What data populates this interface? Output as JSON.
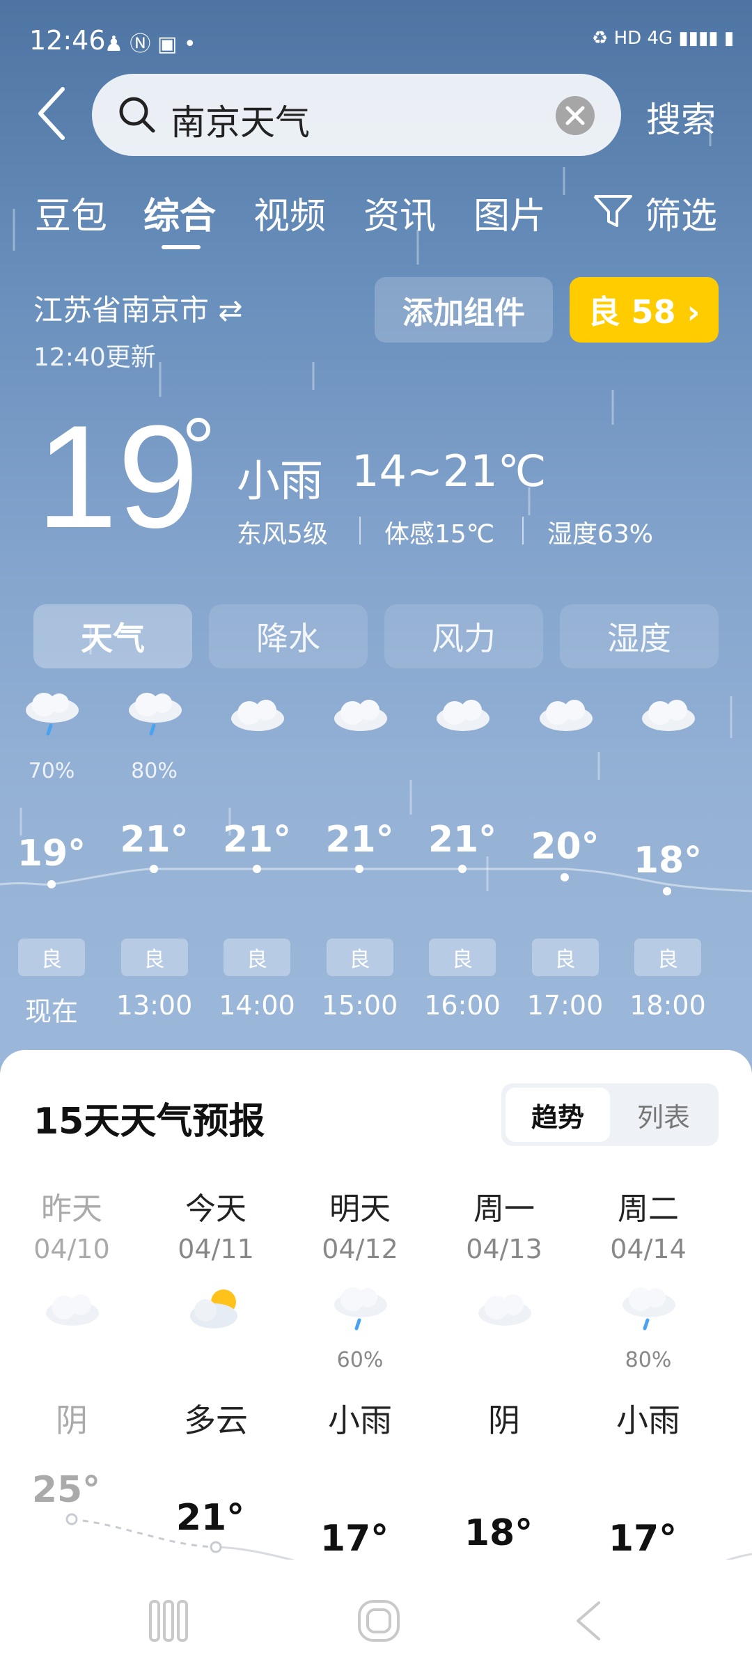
{
  "status_bar": {
    "time": "12:46",
    "left_icons": "♟ Ⓝ ▣ •",
    "right_icons": "♻ HD 4G ▮▮▮▮ ▮"
  },
  "search": {
    "query": "南京天气",
    "button": "搜索"
  },
  "tabs": [
    {
      "label": "豆包",
      "active": false
    },
    {
      "label": "综合",
      "active": true
    },
    {
      "label": "视频",
      "active": false
    },
    {
      "label": "资讯",
      "active": false
    },
    {
      "label": "图片",
      "active": false
    },
    {
      "label": "筛选",
      "active": false
    }
  ],
  "location": {
    "city": "江苏省南京市",
    "swap_icon": "⇄",
    "updated": "12:40更新"
  },
  "buttons": {
    "add_widget": "添加组件",
    "aqi": "良 58 ›"
  },
  "current": {
    "temp": "19",
    "condition": "小雨",
    "range": "14~21℃",
    "wind": "东风5级",
    "feels": "体感15℃",
    "humidity": "湿度63%"
  },
  "segments": [
    {
      "label": "天气",
      "active": true
    },
    {
      "label": "降水",
      "active": false
    },
    {
      "label": "风力",
      "active": false
    },
    {
      "label": "湿度",
      "active": false
    }
  ],
  "hourly": [
    {
      "time": "现在",
      "temp": "19°",
      "icon": "rain-cloud-icon",
      "precip": "70%",
      "aqi": "良"
    },
    {
      "time": "13:00",
      "temp": "21°",
      "icon": "rain-cloud-icon",
      "precip": "80%",
      "aqi": "良"
    },
    {
      "time": "14:00",
      "temp": "21°",
      "icon": "cloud-icon",
      "precip": "",
      "aqi": "良"
    },
    {
      "time": "15:00",
      "temp": "21°",
      "icon": "cloud-icon",
      "precip": "",
      "aqi": "良"
    },
    {
      "time": "16:00",
      "temp": "21°",
      "icon": "cloud-icon",
      "precip": "",
      "aqi": "良"
    },
    {
      "time": "17:00",
      "temp": "20°",
      "icon": "cloud-icon",
      "precip": "",
      "aqi": "良"
    },
    {
      "time": "18:00",
      "temp": "18°",
      "icon": "cloud-icon",
      "precip": "",
      "aqi": "良"
    }
  ],
  "forecast": {
    "title": "15天天气预报",
    "view_trend": "趋势",
    "view_list": "列表",
    "days": [
      {
        "name": "昨天",
        "date": "04/10",
        "icon": "cloud-icon",
        "precip": "",
        "cond": "阴",
        "high": "25°",
        "past": true
      },
      {
        "name": "今天",
        "date": "04/11",
        "icon": "partly-cloudy-icon",
        "precip": "",
        "cond": "多云",
        "high": "21°",
        "past": false
      },
      {
        "name": "明天",
        "date": "04/12",
        "icon": "rain-cloud-icon",
        "precip": "60%",
        "cond": "小雨",
        "high": "17°",
        "past": false
      },
      {
        "name": "周一",
        "date": "04/13",
        "icon": "cloud-icon",
        "precip": "",
        "cond": "阴",
        "high": "18°",
        "past": false
      },
      {
        "name": "周二",
        "date": "04/14",
        "icon": "rain-cloud-icon",
        "precip": "80%",
        "cond": "小雨",
        "high": "17°",
        "past": false
      }
    ]
  },
  "colors": {
    "aqi_good": "#ffcc00",
    "sky_top": "#4e74a3",
    "sky_bottom": "#9ab6d8"
  }
}
